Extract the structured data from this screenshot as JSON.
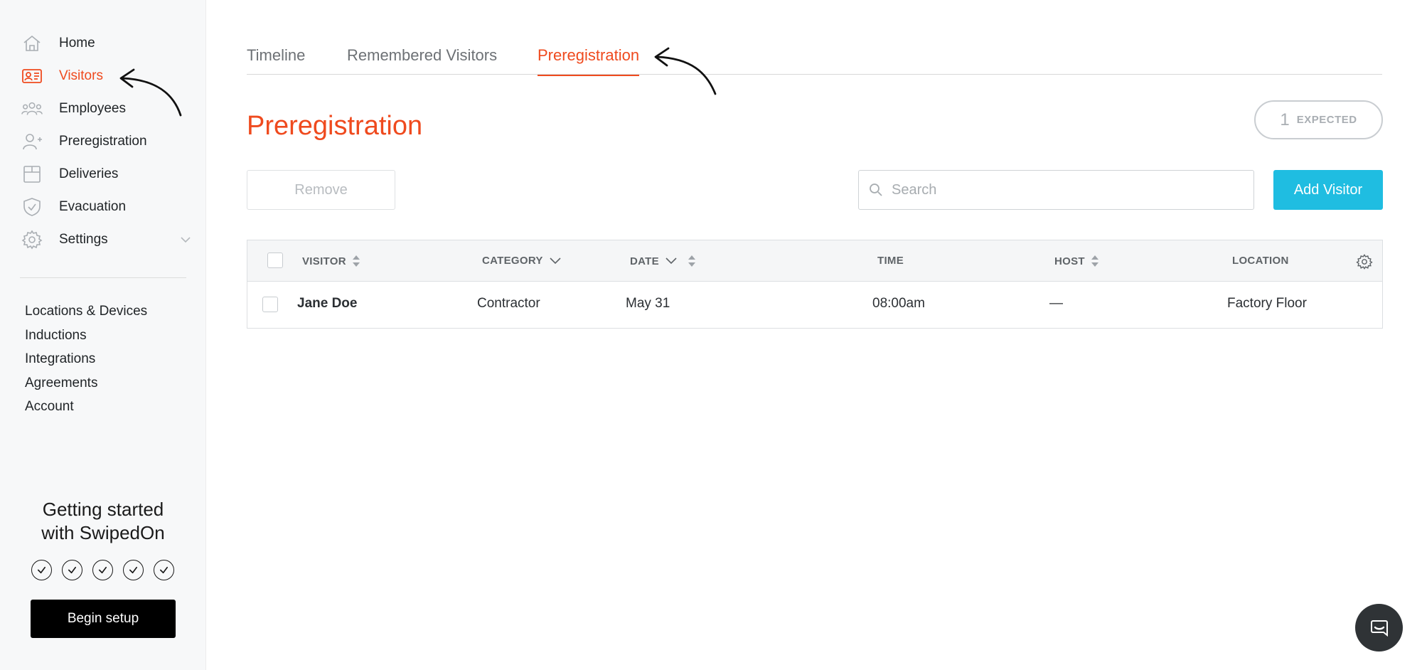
{
  "sidebar": {
    "nav": [
      {
        "label": "Home",
        "icon": "home-icon"
      },
      {
        "label": "Visitors",
        "icon": "id-card-icon",
        "active": true
      },
      {
        "label": "Employees",
        "icon": "people-icon"
      },
      {
        "label": "Preregistration",
        "icon": "user-plus-icon"
      },
      {
        "label": "Deliveries",
        "icon": "box-icon"
      },
      {
        "label": "Evacuation",
        "icon": "shield-check-icon"
      },
      {
        "label": "Settings",
        "icon": "gear-icon"
      }
    ],
    "secondary_links": [
      "Locations & Devices",
      "Inductions",
      "Integrations",
      "Agreements",
      "Account"
    ],
    "getting_started": {
      "line1": "Getting started",
      "line2": "with SwipedOn",
      "steps_completed": 5,
      "button_label": "Begin setup"
    }
  },
  "tabs": [
    "Timeline",
    "Remembered Visitors",
    "Preregistration"
  ],
  "active_tab": "Preregistration",
  "page_title": "Preregistration",
  "expected": {
    "count": "1",
    "label": "EXPECTED"
  },
  "toolbar": {
    "remove_label": "Remove",
    "search_placeholder": "Search",
    "add_label": "Add Visitor"
  },
  "table": {
    "headers": {
      "visitor": "VISITOR",
      "category": "CATEGORY",
      "date": "DATE",
      "time": "TIME",
      "host": "HOST",
      "location": "LOCATION"
    },
    "rows": [
      {
        "visitor": "Jane Doe",
        "category": "Contractor",
        "date": "May 31",
        "time": "08:00am",
        "host": "—",
        "location": "Factory Floor"
      }
    ]
  },
  "colors": {
    "accent": "#ef4a1e",
    "primary_button": "#1fbde1",
    "sidebar_bg": "#f7f8f9"
  }
}
